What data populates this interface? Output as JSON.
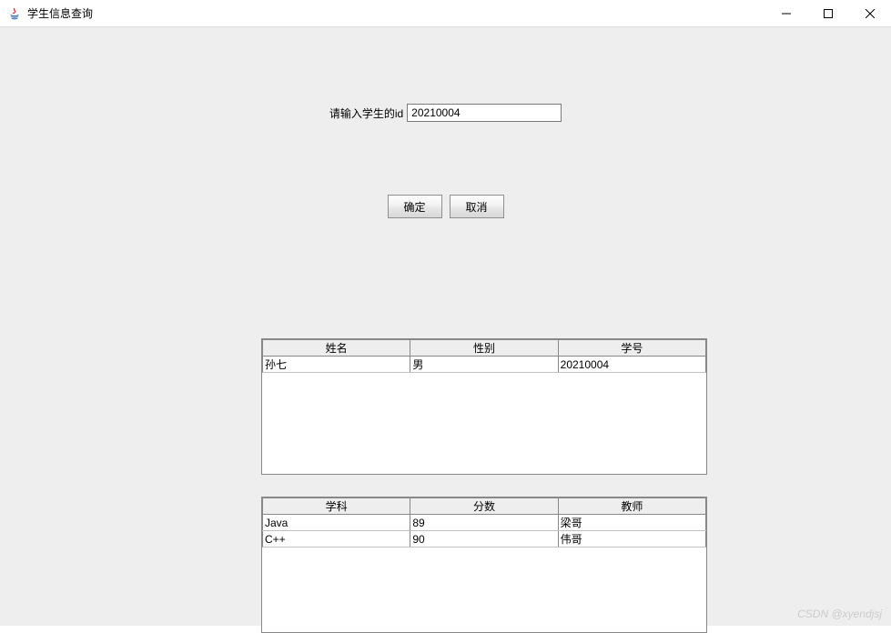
{
  "window": {
    "title": "学生信息查询"
  },
  "form": {
    "input_label": "请输入学生的id",
    "input_value": "20210004",
    "ok_label": "确定",
    "cancel_label": "取消"
  },
  "table1": {
    "headers": [
      "姓名",
      "性别",
      "学号"
    ],
    "rows": [
      {
        "c0": "孙七",
        "c1": "男",
        "c2": "20210004"
      }
    ]
  },
  "table2": {
    "headers": [
      "学科",
      "分数",
      "教师"
    ],
    "rows": [
      {
        "c0": "Java",
        "c1": "89",
        "c2": "梁哥"
      },
      {
        "c0": "C++",
        "c1": "90",
        "c2": "伟哥"
      }
    ]
  },
  "watermark": "CSDN @xyendjsj"
}
